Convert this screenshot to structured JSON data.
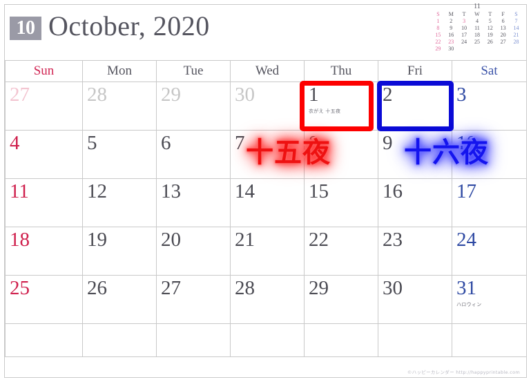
{
  "header": {
    "month_number": "10",
    "title": "October, 2020"
  },
  "mini_calendar": {
    "title": "11",
    "weekdays": [
      "S",
      "M",
      "T",
      "W",
      "T",
      "F",
      "S"
    ],
    "weeks": [
      [
        "1",
        "2",
        "3",
        "4",
        "5",
        "6",
        "7"
      ],
      [
        "8",
        "9",
        "10",
        "11",
        "12",
        "13",
        "14"
      ],
      [
        "15",
        "16",
        "17",
        "18",
        "19",
        "20",
        "21"
      ],
      [
        "22",
        "23",
        "24",
        "25",
        "26",
        "27",
        "28"
      ],
      [
        "29",
        "30",
        "",
        "",
        "",
        "",
        ""
      ]
    ],
    "holiday_days": [
      "3",
      "23"
    ]
  },
  "calendar": {
    "weekday_headers": [
      "Sun",
      "Mon",
      "Tue",
      "Wed",
      "Thu",
      "Fri",
      "Sat"
    ],
    "weeks": [
      [
        {
          "day": "27",
          "other_month": true,
          "note": ""
        },
        {
          "day": "28",
          "other_month": true,
          "note": ""
        },
        {
          "day": "29",
          "other_month": true,
          "note": ""
        },
        {
          "day": "30",
          "other_month": true,
          "note": ""
        },
        {
          "day": "1",
          "other_month": false,
          "note": "衣がえ 十五夜"
        },
        {
          "day": "2",
          "other_month": false,
          "note": ""
        },
        {
          "day": "3",
          "other_month": false,
          "note": ""
        }
      ],
      [
        {
          "day": "4",
          "other_month": false,
          "note": ""
        },
        {
          "day": "5",
          "other_month": false,
          "note": ""
        },
        {
          "day": "6",
          "other_month": false,
          "note": ""
        },
        {
          "day": "7",
          "other_month": false,
          "note": ""
        },
        {
          "day": "8",
          "other_month": false,
          "note": ""
        },
        {
          "day": "9",
          "other_month": false,
          "note": ""
        },
        {
          "day": "10",
          "other_month": false,
          "note": ""
        }
      ],
      [
        {
          "day": "11",
          "other_month": false,
          "note": ""
        },
        {
          "day": "12",
          "other_month": false,
          "note": ""
        },
        {
          "day": "13",
          "other_month": false,
          "note": ""
        },
        {
          "day": "14",
          "other_month": false,
          "note": ""
        },
        {
          "day": "15",
          "other_month": false,
          "note": ""
        },
        {
          "day": "16",
          "other_month": false,
          "note": ""
        },
        {
          "day": "17",
          "other_month": false,
          "note": ""
        }
      ],
      [
        {
          "day": "18",
          "other_month": false,
          "note": ""
        },
        {
          "day": "19",
          "other_month": false,
          "note": ""
        },
        {
          "day": "20",
          "other_month": false,
          "note": ""
        },
        {
          "day": "21",
          "other_month": false,
          "note": ""
        },
        {
          "day": "22",
          "other_month": false,
          "note": ""
        },
        {
          "day": "23",
          "other_month": false,
          "note": ""
        },
        {
          "day": "24",
          "other_month": false,
          "note": ""
        }
      ],
      [
        {
          "day": "25",
          "other_month": false,
          "note": ""
        },
        {
          "day": "26",
          "other_month": false,
          "note": ""
        },
        {
          "day": "27",
          "other_month": false,
          "note": ""
        },
        {
          "day": "28",
          "other_month": false,
          "note": ""
        },
        {
          "day": "29",
          "other_month": false,
          "note": ""
        },
        {
          "day": "30",
          "other_month": false,
          "note": ""
        },
        {
          "day": "31",
          "other_month": false,
          "note": "ハロウィン"
        }
      ],
      [
        {
          "day": "",
          "other_month": false,
          "note": ""
        },
        {
          "day": "",
          "other_month": false,
          "note": ""
        },
        {
          "day": "",
          "other_month": false,
          "note": ""
        },
        {
          "day": "",
          "other_month": false,
          "note": ""
        },
        {
          "day": "",
          "other_month": false,
          "note": ""
        },
        {
          "day": "",
          "other_month": false,
          "note": ""
        },
        {
          "day": "",
          "other_month": false,
          "note": ""
        }
      ]
    ]
  },
  "annotations": {
    "red_label": "十五夜",
    "blue_label": "十六夜"
  },
  "footer": {
    "credit": "©ハッピーカレンダー   http://happyprintable.com"
  },
  "colors": {
    "sunday": "#cf1f4c",
    "saturday": "#2f4aa3",
    "weekday": "#4a4a52",
    "other_month": "#c6c6c6",
    "badge_bg": "#9a9aa6",
    "highlight_red": "#fd0000",
    "highlight_blue": "#0b0bd6",
    "grid_line": "#c9c9c9"
  }
}
